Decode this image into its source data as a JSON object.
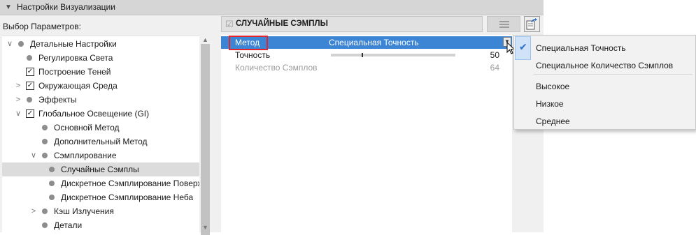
{
  "header": {
    "title": "Настройки Визуализации"
  },
  "left_label": "Выбор Параметров:",
  "tree": [
    {
      "label": "Детальные Настройки",
      "toggle": "∨",
      "mark": "dot",
      "depth": 0
    },
    {
      "label": "Регулировка Света",
      "toggle": "",
      "mark": "dot",
      "depth": 1
    },
    {
      "label": "Построение Теней",
      "toggle": "",
      "mark": "check",
      "depth": 1
    },
    {
      "label": "Окружающая Среда",
      "toggle": ">",
      "mark": "check",
      "depth": 1
    },
    {
      "label": "Эффекты",
      "toggle": ">",
      "mark": "dot",
      "depth": 1
    },
    {
      "label": "Глобальное Освещение (GI)",
      "toggle": "∨",
      "mark": "check",
      "depth": 1
    },
    {
      "label": "Основной Метод",
      "toggle": "",
      "mark": "dot",
      "depth": 2
    },
    {
      "label": "Дополнительный Метод",
      "toggle": "",
      "mark": "dot",
      "depth": 2
    },
    {
      "label": "Сэмплирование",
      "toggle": "∨",
      "mark": "dot",
      "depth": 2
    },
    {
      "label": "Случайные Сэмплы",
      "toggle": "",
      "mark": "dot",
      "depth": 3,
      "selected": true
    },
    {
      "label": "Дискретное Сэмплирование Поверхно",
      "toggle": "",
      "mark": "dot",
      "depth": 3
    },
    {
      "label": "Дискретное Сэмплирование Неба",
      "toggle": "",
      "mark": "dot",
      "depth": 3
    },
    {
      "label": "Кэш Излучения",
      "toggle": ">",
      "mark": "dot",
      "depth": 2
    },
    {
      "label": "Детали",
      "toggle": "",
      "mark": "dot",
      "depth": 2
    }
  ],
  "section": {
    "title": "СЛУЧАЙНЫЕ СЭМПЛЫ"
  },
  "properties": {
    "method": {
      "label": "Метод",
      "value": "Специальная Точность"
    },
    "precision": {
      "label": "Точность",
      "value": "50",
      "level": 0.25
    },
    "samples": {
      "label": "Количество Сэмплов",
      "value": "64"
    }
  },
  "dropdown": {
    "selected": "Специальная Точность",
    "items": [
      "Специальная Точность",
      "Специальное Количество Сэмплов",
      "Высокое",
      "Низкое",
      "Среднее"
    ]
  },
  "icons": {
    "check": "✔",
    "expand": "▸",
    "collapse": "▾",
    "scroll_up": "▲",
    "scroll_down": "▼"
  },
  "colors": {
    "highlight": "#3b85d4",
    "callout": "#e3262b",
    "check": "#2b6ec7"
  }
}
